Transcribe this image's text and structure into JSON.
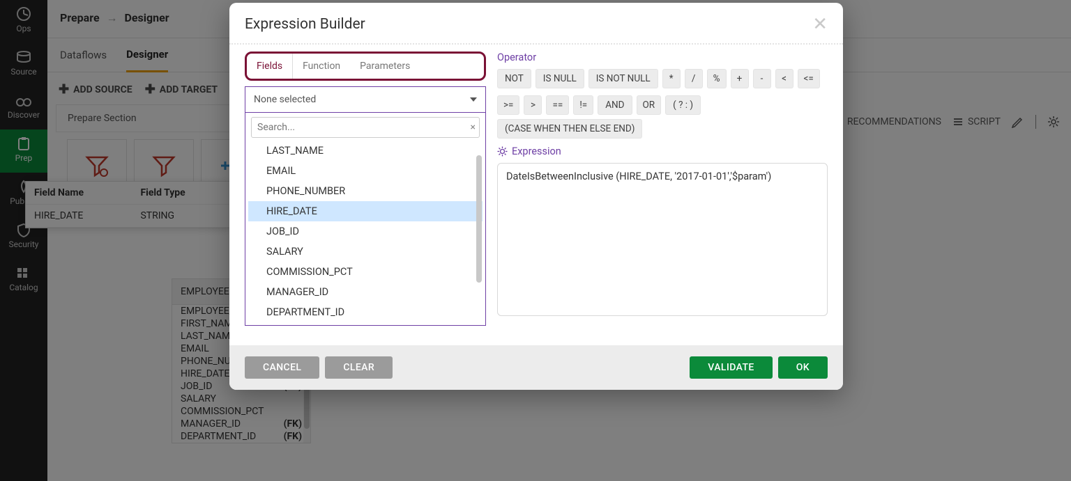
{
  "rail": {
    "items": [
      {
        "label": "Ops"
      },
      {
        "label": "Source"
      },
      {
        "label": "Discover"
      },
      {
        "label": "Prep"
      },
      {
        "label": "Publish"
      },
      {
        "label": "Security"
      },
      {
        "label": "Catalog"
      }
    ]
  },
  "breadcrumb": {
    "root": "Prepare",
    "leaf": "Designer"
  },
  "subtabs": {
    "t0": "Dataflows",
    "t1": "Designer"
  },
  "toolbar": {
    "add_source": "ADD SOURCE",
    "add_target": "ADD TARGET"
  },
  "toolbar_right": {
    "recommendations": "RECOMMENDATIONS",
    "script": "SCRIPT"
  },
  "section": {
    "title": "Prepare Section"
  },
  "tooltip": {
    "h1": "Field Name",
    "h2": "Field Type",
    "c1": "HIRE_DATE",
    "c2": "STRING"
  },
  "tablebox": {
    "title": "EMPLOYEES",
    "columns": [
      {
        "name": "EMPLOYEE_ID",
        "fk": ""
      },
      {
        "name": "FIRST_NAME",
        "fk": ""
      },
      {
        "name": "LAST_NAME",
        "fk": ""
      },
      {
        "name": "EMAIL",
        "fk": ""
      },
      {
        "name": "PHONE_NUMBER",
        "fk": ""
      },
      {
        "name": "HIRE_DATE",
        "fk": ""
      },
      {
        "name": "JOB_ID",
        "fk": "(FK)"
      },
      {
        "name": "SALARY",
        "fk": ""
      },
      {
        "name": "COMMISSION_PCT",
        "fk": ""
      },
      {
        "name": "MANAGER_ID",
        "fk": "(FK)"
      },
      {
        "name": "DEPARTMENT_ID",
        "fk": "(FK)"
      }
    ]
  },
  "modal": {
    "title": "Expression Builder",
    "tabs": {
      "fields": "Fields",
      "function": "Function",
      "parameters": "Parameters"
    },
    "dropdown": "None selected",
    "search_ph": "Search...",
    "fields": [
      "LAST_NAME",
      "EMAIL",
      "PHONE_NUMBER",
      "HIRE_DATE",
      "JOB_ID",
      "SALARY",
      "COMMISSION_PCT",
      "MANAGER_ID",
      "DEPARTMENT_ID"
    ],
    "selected_field": "HIRE_DATE",
    "operator_label": "Operator",
    "ops_row1": [
      "NOT",
      "IS NULL",
      "IS NOT NULL",
      "*",
      "/",
      "%",
      "+",
      "-",
      "<",
      "<="
    ],
    "ops_row2": [
      ">=",
      ">",
      "==",
      "!=",
      "AND",
      "OR",
      "( ? : )",
      "(CASE WHEN THEN ELSE END)"
    ],
    "expression_label": "Expression",
    "expression_value": "DateIsBetweenInclusive (HIRE_DATE, '2017-01-01','$param')",
    "footer": {
      "cancel": "CANCEL",
      "clear": "CLEAR",
      "validate": "VALIDATE",
      "ok": "OK"
    }
  }
}
